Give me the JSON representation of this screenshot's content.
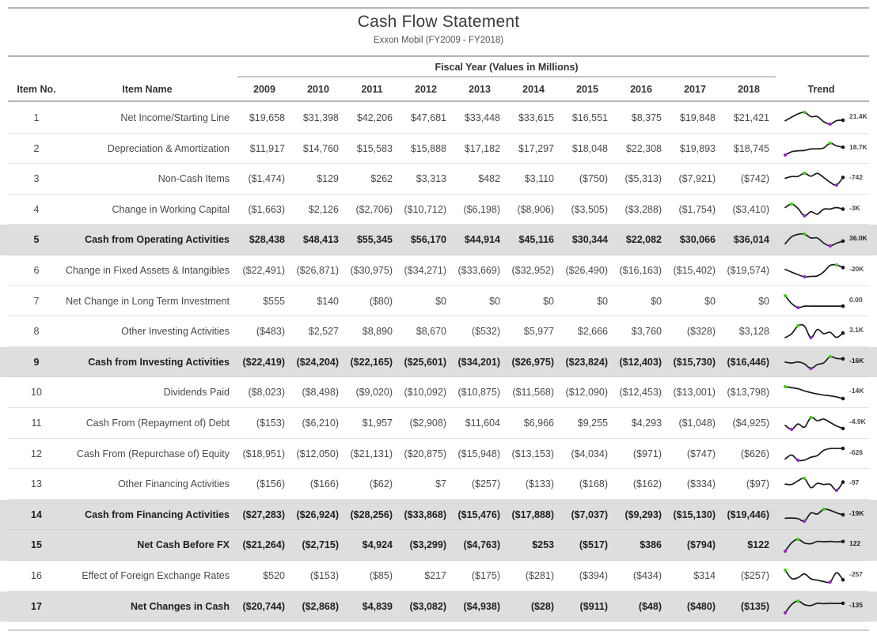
{
  "report": {
    "title": "Cash Flow Statement",
    "subtitle": "Exxon Mobil (FY2009 - FY2018)",
    "group_header": "Fiscal Year (Values in Millions)"
  },
  "colors": {
    "shaded_row": "#dedede",
    "max_marker": "#3fd411",
    "min_marker": "#9b24d6",
    "line": "#1a1a1a",
    "rule": "#b5b5b5"
  },
  "columns": {
    "item_no": "Item No.",
    "item_name": "Item Name",
    "trend": "Trend",
    "years": [
      "2009",
      "2010",
      "2011",
      "2012",
      "2013",
      "2014",
      "2015",
      "2016",
      "2017",
      "2018"
    ]
  },
  "chart_data": {
    "type": "table",
    "title": "Cash Flow Statement",
    "subtitle": "Exxon Mobil (FY2009 - FY2018)",
    "xlabel": "Fiscal Year (Values in Millions)",
    "ylabel": "",
    "categories": [
      "2009",
      "2010",
      "2011",
      "2012",
      "2013",
      "2014",
      "2015",
      "2016",
      "2017",
      "2018"
    ],
    "series": [
      {
        "name": "Net Income/Starting Line",
        "values": [
          19658,
          31398,
          42206,
          47681,
          33448,
          33615,
          16551,
          8375,
          19848,
          21421
        ]
      },
      {
        "name": "Depreciation & Amortization",
        "values": [
          11917,
          14760,
          15583,
          15888,
          17182,
          17297,
          18048,
          22308,
          19893,
          18745
        ]
      },
      {
        "name": "Non-Cash Items",
        "values": [
          -1474,
          129,
          262,
          3313,
          482,
          3110,
          -750,
          -5313,
          -7921,
          -742
        ]
      },
      {
        "name": "Change in Working Capital",
        "values": [
          -1663,
          2126,
          -2706,
          -10712,
          -6198,
          -8906,
          -3505,
          -3288,
          -1754,
          -3410
        ]
      },
      {
        "name": "Cash from Operating Activities",
        "values": [
          28438,
          48413,
          55345,
          56170,
          44914,
          45116,
          30344,
          22082,
          30066,
          36014
        ]
      },
      {
        "name": "Change in Fixed Assets & Intangibles",
        "values": [
          -22491,
          -26871,
          -30975,
          -34271,
          -33669,
          -32952,
          -26490,
          -16163,
          -15402,
          -19574
        ]
      },
      {
        "name": "Net Change in Long Term Investment",
        "values": [
          555,
          140,
          -80,
          0,
          0,
          0,
          0,
          0,
          0,
          0
        ]
      },
      {
        "name": "Other Investing Activities",
        "values": [
          -483,
          2527,
          8890,
          8670,
          -532,
          5977,
          2666,
          3760,
          -328,
          3128
        ]
      },
      {
        "name": "Cash from Investing Activities",
        "values": [
          -22419,
          -24204,
          -22165,
          -25601,
          -34201,
          -26975,
          -23824,
          -12403,
          -15730,
          -16446
        ]
      },
      {
        "name": "Dividends Paid",
        "values": [
          -8023,
          -8498,
          -9020,
          -10092,
          -10875,
          -11568,
          -12090,
          -12453,
          -13001,
          -13798
        ]
      },
      {
        "name": "Cash From (Repayment of) Debt",
        "values": [
          -153,
          -6210,
          1957,
          -2908,
          11604,
          6966,
          9255,
          4293,
          -1048,
          -4925
        ]
      },
      {
        "name": "Cash From (Repurchase of) Equity",
        "values": [
          -18951,
          -12050,
          -21131,
          -20875,
          -15948,
          -13153,
          -4034,
          -971,
          -747,
          -626
        ]
      },
      {
        "name": "Other Financing Activities",
        "values": [
          -156,
          -166,
          -62,
          7,
          -257,
          -133,
          -168,
          -162,
          -334,
          -97
        ]
      },
      {
        "name": "Cash from Financing Activities",
        "values": [
          -27283,
          -26924,
          -28256,
          -33868,
          -15476,
          -17888,
          -7037,
          -9293,
          -15130,
          -19446
        ]
      },
      {
        "name": "Net Cash Before FX",
        "values": [
          -21264,
          -2715,
          4924,
          -3299,
          -4763,
          253,
          -517,
          386,
          -794,
          122
        ]
      },
      {
        "name": "Effect of Foreign Exchange Rates",
        "values": [
          520,
          -153,
          -85,
          217,
          -175,
          -281,
          -394,
          -434,
          314,
          -257
        ]
      },
      {
        "name": "Net Changes in Cash",
        "values": [
          -20744,
          -2868,
          4839,
          -3082,
          -4938,
          -28,
          -911,
          -48,
          -480,
          -135
        ]
      }
    ]
  },
  "rows": [
    {
      "no": "1",
      "name": "Net Income/Starting Line",
      "highlight": false,
      "values": [
        "$19,658",
        "$31,398",
        "$42,206",
        "$47,681",
        "$33,448",
        "$33,615",
        "$16,551",
        "$8,375",
        "$19,848",
        "$21,421"
      ],
      "numeric": [
        19658,
        31398,
        42206,
        47681,
        33448,
        33615,
        16551,
        8375,
        19848,
        21421
      ],
      "trend_label": "21.4K"
    },
    {
      "no": "2",
      "name": "Depreciation & Amortization",
      "highlight": false,
      "values": [
        "$11,917",
        "$14,760",
        "$15,583",
        "$15,888",
        "$17,182",
        "$17,297",
        "$18,048",
        "$22,308",
        "$19,893",
        "$18,745"
      ],
      "numeric": [
        11917,
        14760,
        15583,
        15888,
        17182,
        17297,
        18048,
        22308,
        19893,
        18745
      ],
      "trend_label": "18.7K"
    },
    {
      "no": "3",
      "name": "Non-Cash Items",
      "highlight": false,
      "values": [
        "($1,474)",
        "$129",
        "$262",
        "$3,313",
        "$482",
        "$3,110",
        "($750)",
        "($5,313)",
        "($7,921)",
        "($742)"
      ],
      "numeric": [
        -1474,
        129,
        262,
        3313,
        482,
        3110,
        -750,
        -5313,
        -7921,
        -742
      ],
      "trend_label": "-742"
    },
    {
      "no": "4",
      "name": "Change in Working Capital",
      "highlight": false,
      "values": [
        "($1,663)",
        "$2,126",
        "($2,706)",
        "($10,712)",
        "($6,198)",
        "($8,906)",
        "($3,505)",
        "($3,288)",
        "($1,754)",
        "($3,410)"
      ],
      "numeric": [
        -1663,
        2126,
        -2706,
        -10712,
        -6198,
        -8906,
        -3505,
        -3288,
        -1754,
        -3410
      ],
      "trend_label": "-3K"
    },
    {
      "no": "5",
      "name": "Cash from Operating Activities",
      "highlight": true,
      "values": [
        "$28,438",
        "$48,413",
        "$55,345",
        "$56,170",
        "$44,914",
        "$45,116",
        "$30,344",
        "$22,082",
        "$30,066",
        "$36,014"
      ],
      "numeric": [
        28438,
        48413,
        55345,
        56170,
        44914,
        45116,
        30344,
        22082,
        30066,
        36014
      ],
      "trend_label": "36.0K"
    },
    {
      "no": "6",
      "name": "Change in Fixed Assets & Intangibles",
      "highlight": false,
      "values": [
        "($22,491)",
        "($26,871)",
        "($30,975)",
        "($34,271)",
        "($33,669)",
        "($32,952)",
        "($26,490)",
        "($16,163)",
        "($15,402)",
        "($19,574)"
      ],
      "numeric": [
        -22491,
        -26871,
        -30975,
        -34271,
        -33669,
        -32952,
        -26490,
        -16163,
        -15402,
        -19574
      ],
      "trend_label": "-20K"
    },
    {
      "no": "7",
      "name": "Net Change in Long Term Investment",
      "highlight": false,
      "values": [
        "$555",
        "$140",
        "($80)",
        "$0",
        "$0",
        "$0",
        "$0",
        "$0",
        "$0",
        "$0"
      ],
      "numeric": [
        555,
        140,
        -80,
        0,
        0,
        0,
        0,
        0,
        0,
        0
      ],
      "trend_label": "0.00"
    },
    {
      "no": "8",
      "name": "Other Investing Activities",
      "highlight": false,
      "values": [
        "($483)",
        "$2,527",
        "$8,890",
        "$8,670",
        "($532)",
        "$5,977",
        "$2,666",
        "$3,760",
        "($328)",
        "$3,128"
      ],
      "numeric": [
        -483,
        2527,
        8890,
        8670,
        -532,
        5977,
        2666,
        3760,
        -328,
        3128
      ],
      "trend_label": "3.1K"
    },
    {
      "no": "9",
      "name": "Cash from Investing Activities",
      "highlight": true,
      "values": [
        "($22,419)",
        "($24,204)",
        "($22,165)",
        "($25,601)",
        "($34,201)",
        "($26,975)",
        "($23,824)",
        "($12,403)",
        "($15,730)",
        "($16,446)"
      ],
      "numeric": [
        -22419,
        -24204,
        -22165,
        -25601,
        -34201,
        -26975,
        -23824,
        -12403,
        -15730,
        -16446
      ],
      "trend_label": "-16K"
    },
    {
      "no": "10",
      "name": "Dividends Paid",
      "highlight": false,
      "values": [
        "($8,023)",
        "($8,498)",
        "($9,020)",
        "($10,092)",
        "($10,875)",
        "($11,568)",
        "($12,090)",
        "($12,453)",
        "($13,001)",
        "($13,798)"
      ],
      "numeric": [
        -8023,
        -8498,
        -9020,
        -10092,
        -10875,
        -11568,
        -12090,
        -12453,
        -13001,
        -13798
      ],
      "trend_label": "-14K"
    },
    {
      "no": "11",
      "name": "Cash From (Repayment of) Debt",
      "highlight": false,
      "values": [
        "($153)",
        "($6,210)",
        "$1,957",
        "($2,908)",
        "$11,604",
        "$6,966",
        "$9,255",
        "$4,293",
        "($1,048)",
        "($4,925)"
      ],
      "numeric": [
        -153,
        -6210,
        1957,
        -2908,
        11604,
        6966,
        9255,
        4293,
        -1048,
        -4925
      ],
      "trend_label": "-4.9K"
    },
    {
      "no": "12",
      "name": "Cash From (Repurchase of) Equity",
      "highlight": false,
      "values": [
        "($18,951)",
        "($12,050)",
        "($21,131)",
        "($20,875)",
        "($15,948)",
        "($13,153)",
        "($4,034)",
        "($971)",
        "($747)",
        "($626)"
      ],
      "numeric": [
        -18951,
        -12050,
        -21131,
        -20875,
        -15948,
        -13153,
        -4034,
        -971,
        -747,
        -626
      ],
      "trend_label": "-626"
    },
    {
      "no": "13",
      "name": "Other Financing Activities",
      "highlight": false,
      "values": [
        "($156)",
        "($166)",
        "($62)",
        "$7",
        "($257)",
        "($133)",
        "($168)",
        "($162)",
        "($334)",
        "($97)"
      ],
      "numeric": [
        -156,
        -166,
        -62,
        7,
        -257,
        -133,
        -168,
        -162,
        -334,
        -97
      ],
      "trend_label": "-97"
    },
    {
      "no": "14",
      "name": "Cash from Financing Activities",
      "highlight": true,
      "values": [
        "($27,283)",
        "($26,924)",
        "($28,256)",
        "($33,868)",
        "($15,476)",
        "($17,888)",
        "($7,037)",
        "($9,293)",
        "($15,130)",
        "($19,446)"
      ],
      "numeric": [
        -27283,
        -26924,
        -28256,
        -33868,
        -15476,
        -17888,
        -7037,
        -9293,
        -15130,
        -19446
      ],
      "trend_label": "-19K"
    },
    {
      "no": "15",
      "name": "Net Cash Before FX",
      "highlight": true,
      "values": [
        "($21,264)",
        "($2,715)",
        "$4,924",
        "($3,299)",
        "($4,763)",
        "$253",
        "($517)",
        "$386",
        "($794)",
        "$122"
      ],
      "numeric": [
        -21264,
        -2715,
        4924,
        -3299,
        -4763,
        253,
        -517,
        386,
        -794,
        122
      ],
      "trend_label": "122"
    },
    {
      "no": "16",
      "name": "Effect of Foreign Exchange Rates",
      "highlight": false,
      "values": [
        "$520",
        "($153)",
        "($85)",
        "$217",
        "($175)",
        "($281)",
        "($394)",
        "($434)",
        "$314",
        "($257)"
      ],
      "numeric": [
        520,
        -153,
        -85,
        217,
        -175,
        -281,
        -394,
        -434,
        314,
        -257
      ],
      "trend_label": "-257"
    },
    {
      "no": "17",
      "name": "Net Changes in Cash",
      "highlight": true,
      "values": [
        "($20,744)",
        "($2,868)",
        "$4,839",
        "($3,082)",
        "($4,938)",
        "($28)",
        "($911)",
        "($48)",
        "($480)",
        "($135)"
      ],
      "numeric": [
        -20744,
        -2868,
        4839,
        -3082,
        -4938,
        -28,
        -911,
        -48,
        -480,
        -135
      ],
      "trend_label": "-135"
    }
  ]
}
